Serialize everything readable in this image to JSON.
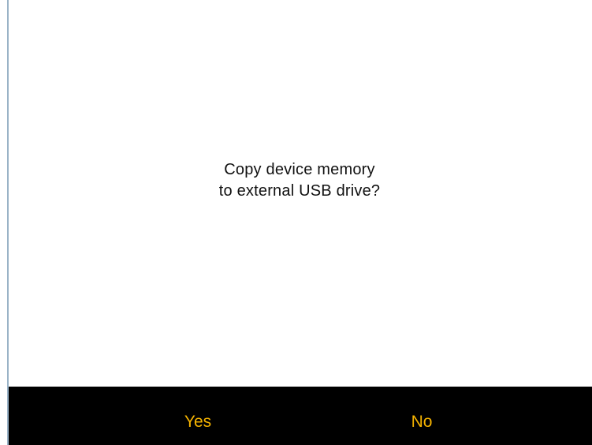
{
  "dialog": {
    "message_line1": "Copy device memory",
    "message_line2": "to external USB drive?"
  },
  "buttons": {
    "yes_label": "Yes",
    "no_label": "No"
  },
  "colors": {
    "background": "#ffffff",
    "bar_background": "#000000",
    "button_text": "#f5b300",
    "message_text": "#111111",
    "edge_line": "#9ab3c7"
  }
}
